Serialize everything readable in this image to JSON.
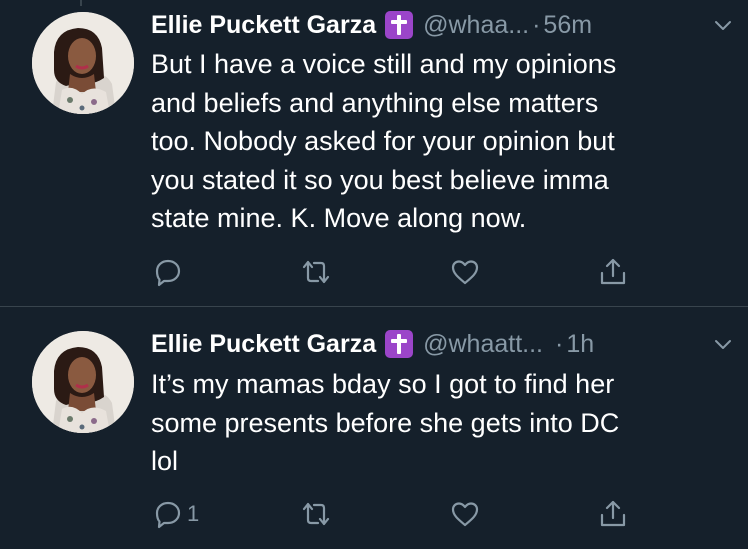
{
  "tweets": [
    {
      "display_name": "Ellie Puckett Garza",
      "badge_icon": "latin-cross-emoji",
      "handle": "@whaa...",
      "separator": "·",
      "time": "56m",
      "text": "But I have a voice still and my opinions\nand beliefs and anything else matters\ntoo. Nobody asked for your opinion but\nyou stated it so you best believe imma\nstate mine. K. Move along now.",
      "reply_count": ""
    },
    {
      "display_name": "Ellie Puckett Garza",
      "badge_icon": "latin-cross-emoji",
      "handle": "@whaatt...",
      "separator": "·",
      "time": "1h",
      "text": "It’s my mamas bday so I got to find her\nsome presents before she gets into DC\nlol",
      "reply_count": "1"
    }
  ],
  "colors": {
    "background": "#15202b",
    "text": "#ffffff",
    "secondary": "#8899a6",
    "divider": "#38444d",
    "badge": "#9b45c9"
  }
}
